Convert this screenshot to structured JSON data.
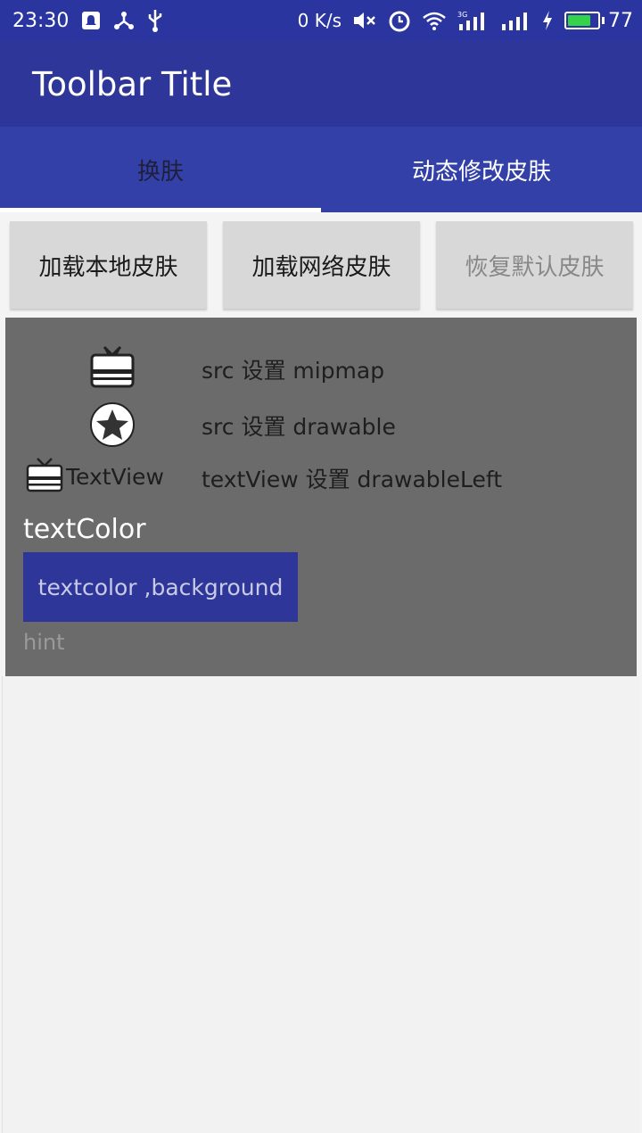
{
  "status_bar": {
    "time": "23:30",
    "net_speed": "0 K/s",
    "battery_level": "77",
    "icons": [
      "notification-icon",
      "share-icon",
      "usb-icon",
      "mute-icon",
      "alarm-icon",
      "wifi-icon",
      "signal-3g-icon",
      "signal-icon",
      "charging-icon",
      "battery-icon"
    ]
  },
  "toolbar": {
    "title": "Toolbar Title"
  },
  "tabs": [
    {
      "label": "换肤",
      "active": true
    },
    {
      "label": "动态修改皮肤",
      "active": false
    }
  ],
  "buttons": [
    {
      "label": "加载本地皮肤"
    },
    {
      "label": "加载网络皮肤"
    },
    {
      "label": "恢复默认皮肤",
      "disabled": true
    }
  ],
  "panel": {
    "src_mipmap_label": "src 设置 mipmap",
    "src_drawable_label": "src 设置 drawable",
    "textview_text": "TextView",
    "textview_label": "textView 设置 drawableLeft",
    "textcolor_text": "textColor",
    "bg_button_text": "textcolor ,background",
    "hint_text": "hint"
  },
  "colors": {
    "primary": "#2e3799",
    "panel_bg": "#6b6b6b",
    "battery_green": "#35d34a"
  }
}
